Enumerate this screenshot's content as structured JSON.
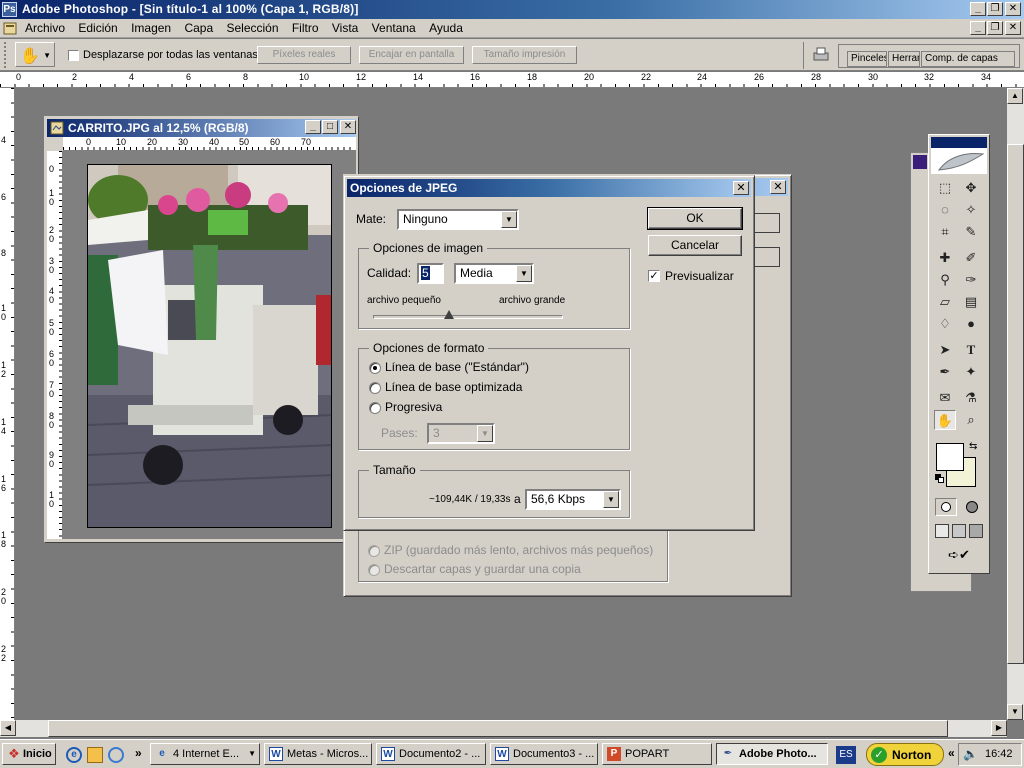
{
  "app": {
    "title": "Adobe Photoshop - [Sin título-1 al 100% (Capa 1, RGB/8)]",
    "menu": [
      "Archivo",
      "Edición",
      "Imagen",
      "Capa",
      "Selección",
      "Filtro",
      "Vista",
      "Ventana",
      "Ayuda"
    ]
  },
  "options_bar": {
    "scroll_all_label": "Desplazarse por todas las ventanas",
    "actual_pixels": "Píxeles reales",
    "fit_screen": "Encajar en pantalla",
    "print_size": "Tamaño impresión",
    "palette_tabs": [
      "Pinceles",
      "Herramientas",
      "Comp. de capas"
    ]
  },
  "top_ruler": [
    "0",
    "2",
    "4",
    "6",
    "8",
    "10",
    "12",
    "14",
    "16",
    "18",
    "20",
    "22",
    "24",
    "26",
    "28",
    "30",
    "32",
    "34"
  ],
  "left_ruler": [
    "4",
    "6",
    "8",
    "1\n0",
    "1\n2",
    "1\n4",
    "1\n6",
    "1\n8",
    "2\n0",
    "2\n2"
  ],
  "document": {
    "title": "CARRITO.JPG al 12,5% (RGB/8)",
    "ruler_top": [
      "0",
      "10",
      "20",
      "30",
      "40",
      "50",
      "60",
      "70"
    ],
    "ruler_left": [
      "0",
      "1\n0",
      "2\n0",
      "3\n0",
      "4\n0",
      "5\n0",
      "6\n0",
      "7\n0",
      "8\n0",
      "9\n0",
      "1\n0"
    ]
  },
  "background_dialog": {
    "zip_option": "ZIP (guardado más lento, archivos más pequeños)",
    "discard_option": "Descartar capas y guardar una copia"
  },
  "jpeg_dialog": {
    "title": "Opciones de JPEG",
    "matte_label": "Mate:",
    "matte_value": "Ninguno",
    "image_options_legend": "Opciones de imagen",
    "quality_label": "Calidad:",
    "quality_value": "5",
    "quality_preset": "Media",
    "small_file": "archivo pequeño",
    "large_file": "archivo grande",
    "quality_fraction": 0.4,
    "format_options_legend": "Opciones de formato",
    "format_baseline": "Línea de base (\"Estándar\")",
    "format_optimized": "Línea de base optimizada",
    "format_progressive": "Progresiva",
    "passes_label": "Pases:",
    "passes_value": "3",
    "size_legend": "Tamaño",
    "size_text": "~109,44K / 19,33s",
    "size_at": "a",
    "speed_value": "56,6 Kbps",
    "ok": "OK",
    "cancel": "Cancelar",
    "preview_label": "Previsualizar"
  },
  "taskbar": {
    "start": "Inicio",
    "items": [
      "4 Internet E...",
      "Metas - Micros...",
      "Documento2 - ...",
      "Documento3 - ...",
      "POPART",
      "Adobe Photo..."
    ],
    "lang": "ES",
    "norton": "Norton",
    "clock": "16:42"
  },
  "colors": {
    "titlebar_start": "#0a246a",
    "titlebar_end": "#a6caf0",
    "face": "#d4d0c8",
    "workspace": "#7a7a7a"
  }
}
